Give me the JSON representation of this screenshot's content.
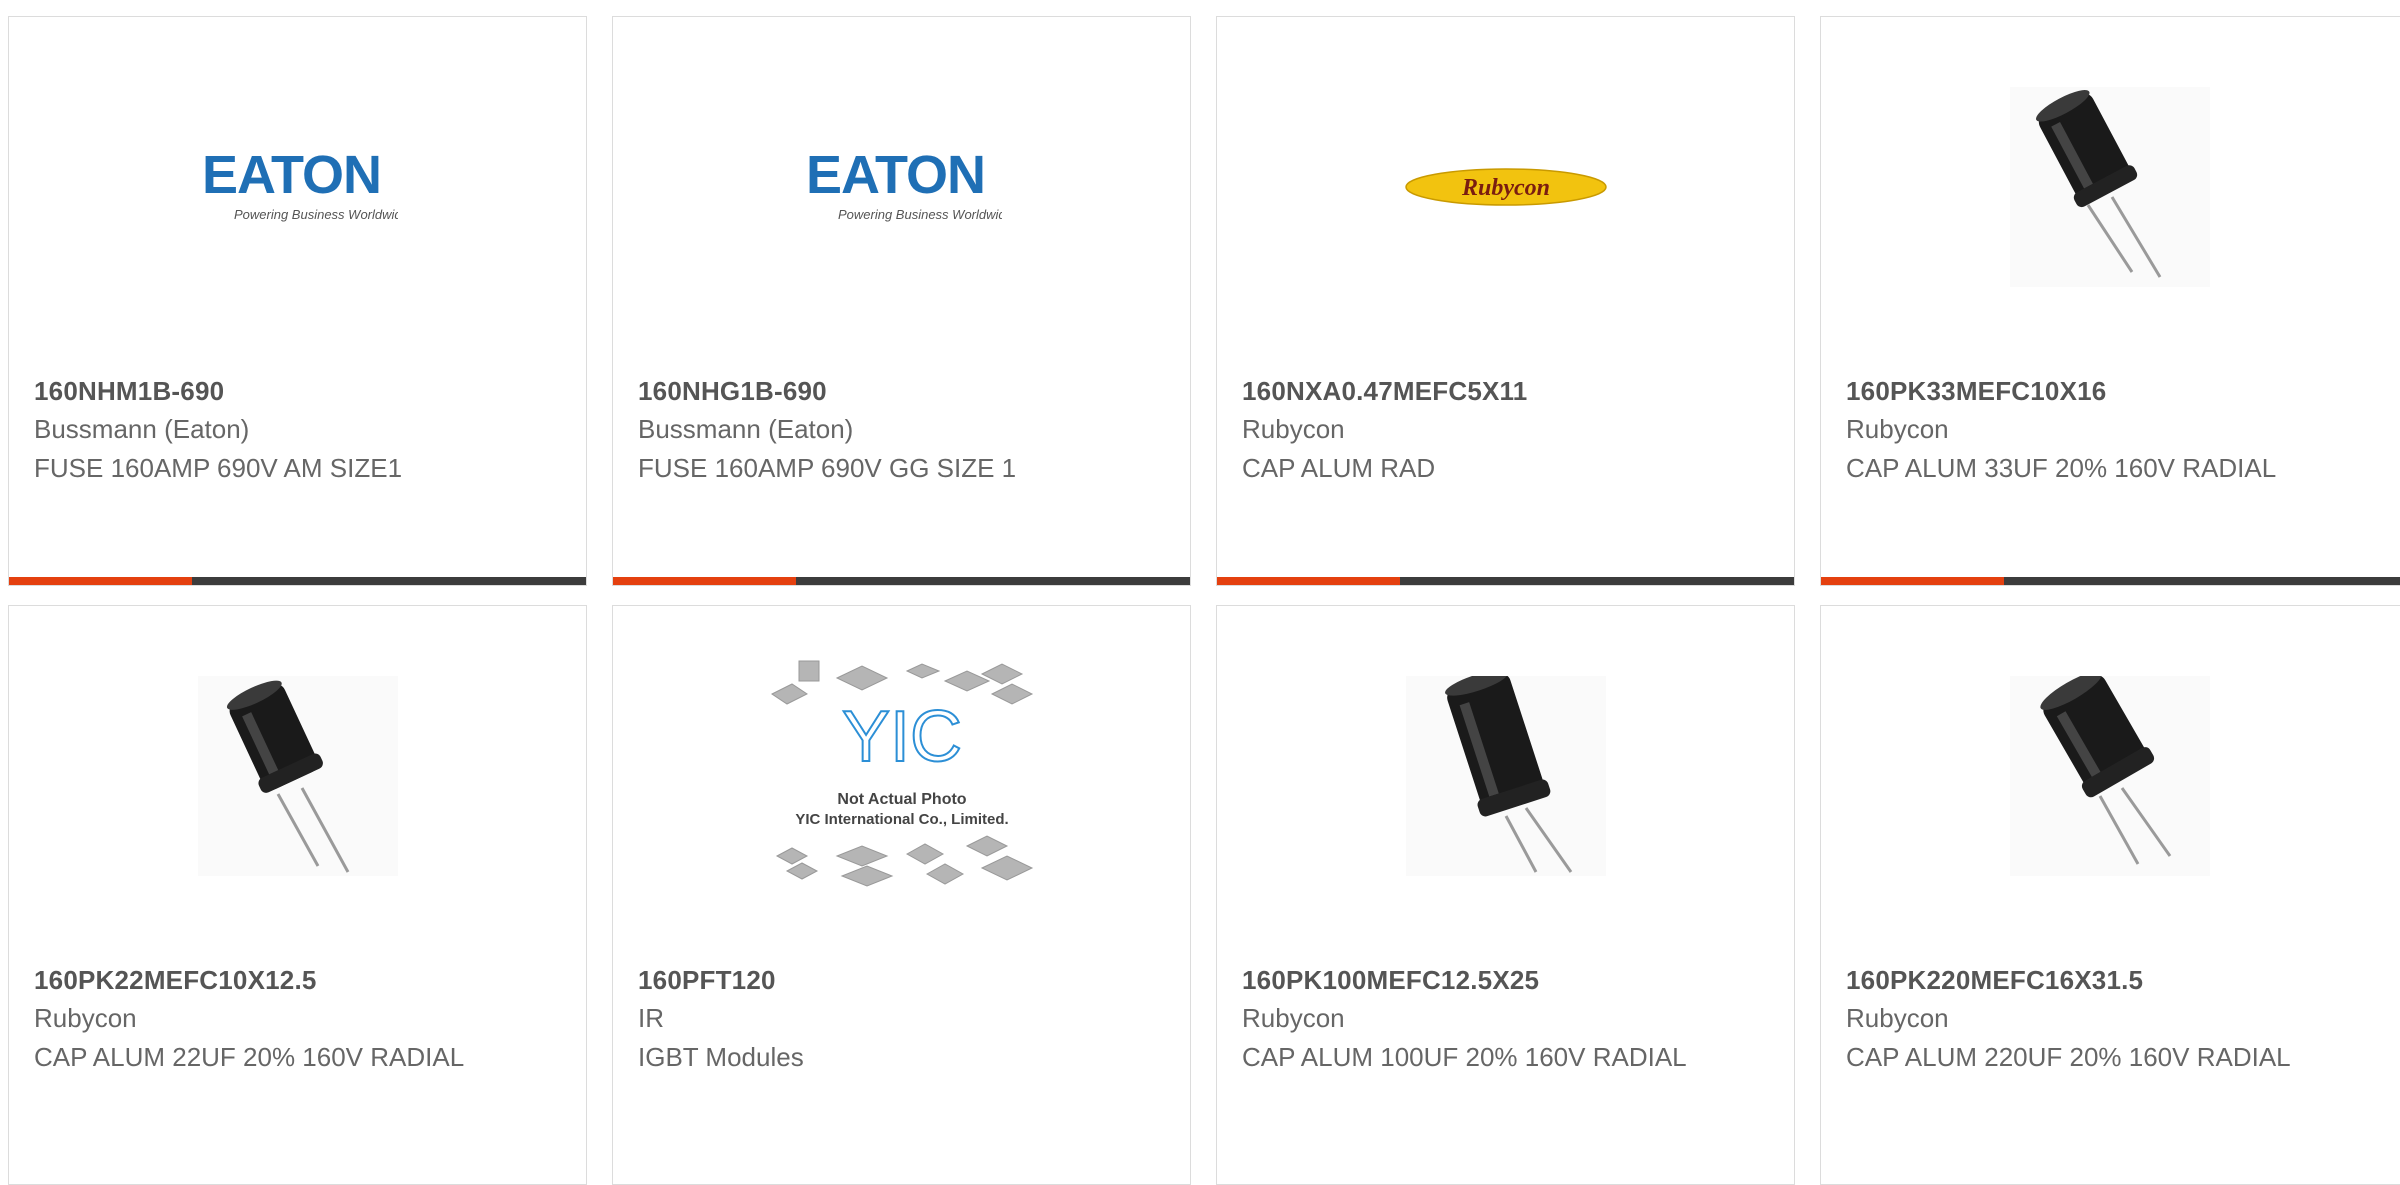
{
  "accent_color": "#e4400f",
  "bar_color": "#3c3c3c",
  "products": [
    {
      "part": "160NHM1B-690",
      "manufacturer": "Bussmann (Eaton)",
      "description": "FUSE 160AMP 690V AM SIZE1",
      "image": "eaton-logo",
      "logo_text": "EATON",
      "logo_tagline": "Powering Business Worldwide"
    },
    {
      "part": "160NHG1B-690",
      "manufacturer": "Bussmann (Eaton)",
      "description": "FUSE 160AMP 690V GG SIZE 1",
      "image": "eaton-logo",
      "logo_text": "EATON",
      "logo_tagline": "Powering Business Worldwide"
    },
    {
      "part": "160NXA0.47MEFC5X11",
      "manufacturer": "Rubycon",
      "description": "CAP ALUM RAD",
      "image": "rubycon-logo",
      "logo_text": "Rubycon"
    },
    {
      "part": "160PK33MEFC10X16",
      "manufacturer": "Rubycon",
      "description": "CAP ALUM 33UF 20% 160V RADIAL",
      "image": "radial-capacitor-photo"
    },
    {
      "part": "160PK22MEFC10X12.5",
      "manufacturer": "Rubycon",
      "description": "CAP ALUM 22UF 20% 160V RADIAL",
      "image": "radial-capacitor-photo"
    },
    {
      "part": "160PFT120",
      "manufacturer": "IR",
      "description": "IGBT Modules",
      "image": "not-actual-photo-placeholder",
      "logo_text": "YIC",
      "photo_line1": "Not Actual Photo",
      "photo_line2": "YIC International Co., Limited."
    },
    {
      "part": "160PK100MEFC12.5X25",
      "manufacturer": "Rubycon",
      "description": "CAP ALUM 100UF 20% 160V RADIAL",
      "image": "radial-capacitor-photo"
    },
    {
      "part": "160PK220MEFC16X31.5",
      "manufacturer": "Rubycon",
      "description": "CAP ALUM 220UF 20% 160V RADIAL",
      "image": "radial-capacitor-photo"
    }
  ]
}
